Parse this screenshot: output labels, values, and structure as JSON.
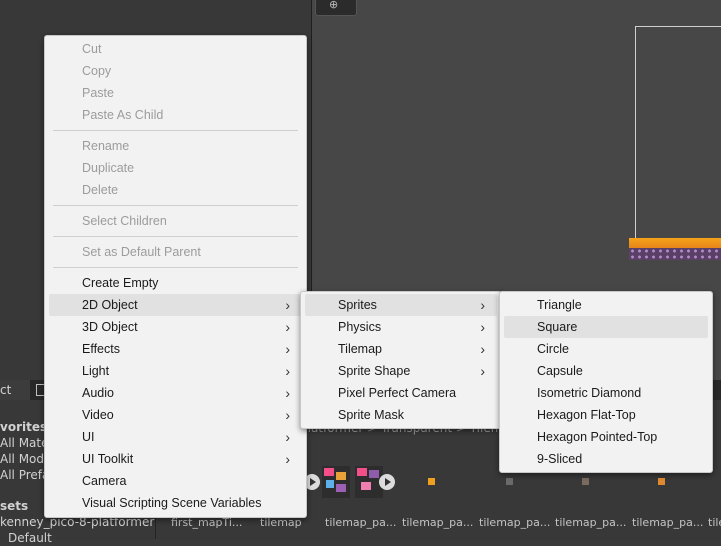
{
  "scene": {
    "tool_icon": "gizmo-icon"
  },
  "project": {
    "tab_label": "ct",
    "tree": [
      "vorites",
      "All Mater",
      "All Mode",
      "All Prefa",
      "sets",
      "kenney_pico-8-platformer",
      "Default"
    ],
    "breadcrumb": "platformer  >  Transparent  >  Tilem",
    "assets": [
      "first_mapTi...",
      "tilemap",
      "tilemap_pa...",
      "tilemap_pa...",
      "tilemap_pa...",
      "tilemap_pa...",
      "tilemap_pa...",
      "tilem"
    ]
  },
  "main_menu": {
    "items": [
      {
        "label": "Cut",
        "enabled": false
      },
      {
        "label": "Copy",
        "enabled": false
      },
      {
        "label": "Paste",
        "enabled": false
      },
      {
        "label": "Paste As Child",
        "enabled": false
      },
      {
        "label": "Rename",
        "enabled": false
      },
      {
        "label": "Duplicate",
        "enabled": false
      },
      {
        "label": "Delete",
        "enabled": false
      },
      {
        "label": "Select Children",
        "enabled": false
      },
      {
        "label": "Set as Default Parent",
        "enabled": false
      },
      {
        "label": "Create Empty",
        "enabled": true
      },
      {
        "label": "2D Object",
        "enabled": true,
        "submenu": true,
        "highlighted": true
      },
      {
        "label": "3D Object",
        "enabled": true,
        "submenu": true
      },
      {
        "label": "Effects",
        "enabled": true,
        "submenu": true
      },
      {
        "label": "Light",
        "enabled": true,
        "submenu": true
      },
      {
        "label": "Audio",
        "enabled": true,
        "submenu": true
      },
      {
        "label": "Video",
        "enabled": true,
        "submenu": true
      },
      {
        "label": "UI",
        "enabled": true,
        "submenu": true
      },
      {
        "label": "UI Toolkit",
        "enabled": true,
        "submenu": true
      },
      {
        "label": "Camera",
        "enabled": true
      },
      {
        "label": "Visual Scripting Scene Variables",
        "enabled": true
      }
    ]
  },
  "sub_menu": {
    "items": [
      {
        "label": "Sprites",
        "submenu": true,
        "highlighted": true
      },
      {
        "label": "Physics",
        "submenu": true
      },
      {
        "label": "Tilemap",
        "submenu": true
      },
      {
        "label": "Sprite Shape",
        "submenu": true
      },
      {
        "label": "Pixel Perfect Camera"
      },
      {
        "label": "Sprite Mask"
      }
    ]
  },
  "sprites_menu": {
    "items": [
      {
        "label": "Triangle"
      },
      {
        "label": "Square",
        "highlighted": true
      },
      {
        "label": "Circle"
      },
      {
        "label": "Capsule"
      },
      {
        "label": "Isometric Diamond"
      },
      {
        "label": "Hexagon Flat-Top"
      },
      {
        "label": "Hexagon Pointed-Top"
      },
      {
        "label": "9-Sliced"
      }
    ]
  },
  "chevron_glyph": "›",
  "colors": {
    "menu_bg": "#f2f2f2",
    "highlight": "#e1e1e1",
    "disabled_text": "#9c9c9c",
    "accent_orange": "#f6a21a"
  }
}
